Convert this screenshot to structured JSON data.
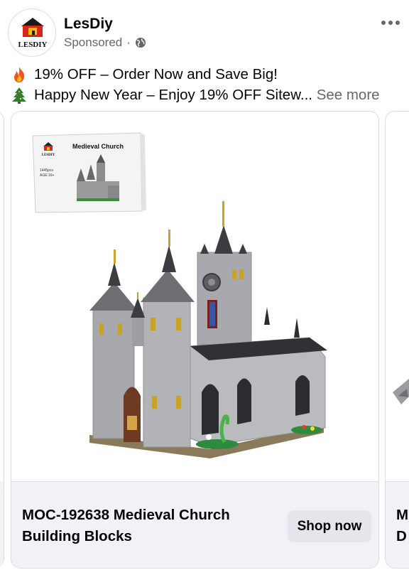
{
  "header": {
    "page_name": "LesDiy",
    "sponsored_label": "Sponsored",
    "dot": "·",
    "logo_text": "LESDIY",
    "icons": [
      "lesdiy-logo-icon",
      "globe-icon",
      "more-options-icon"
    ]
  },
  "ad": {
    "line1": "19% OFF – Order Now and Save Big!",
    "line2": "Happy New Year – Enjoy 19% OFF Sitew...",
    "see_more": "See more",
    "line1_icon": "fire-icon",
    "line2_icon": "christmas-tree-icon"
  },
  "carousel": {
    "cards": [
      {
        "box_title": "Medieval Church",
        "box_logo_text": "LESDIY",
        "box_pieces": "1445pcs",
        "box_age": "AGE:16+",
        "title_line1": "MOC-192638 Medieval Church",
        "title_line2": "Building Blocks",
        "cta": "Shop now"
      },
      {
        "title_line1": "M",
        "title_line2": "D"
      }
    ]
  },
  "colors": {
    "text_primary": "#050505",
    "text_secondary": "#65676b",
    "card_footer_bg": "#f0f2f5",
    "button_bg": "#e4e6eb",
    "border": "#dadde1"
  }
}
